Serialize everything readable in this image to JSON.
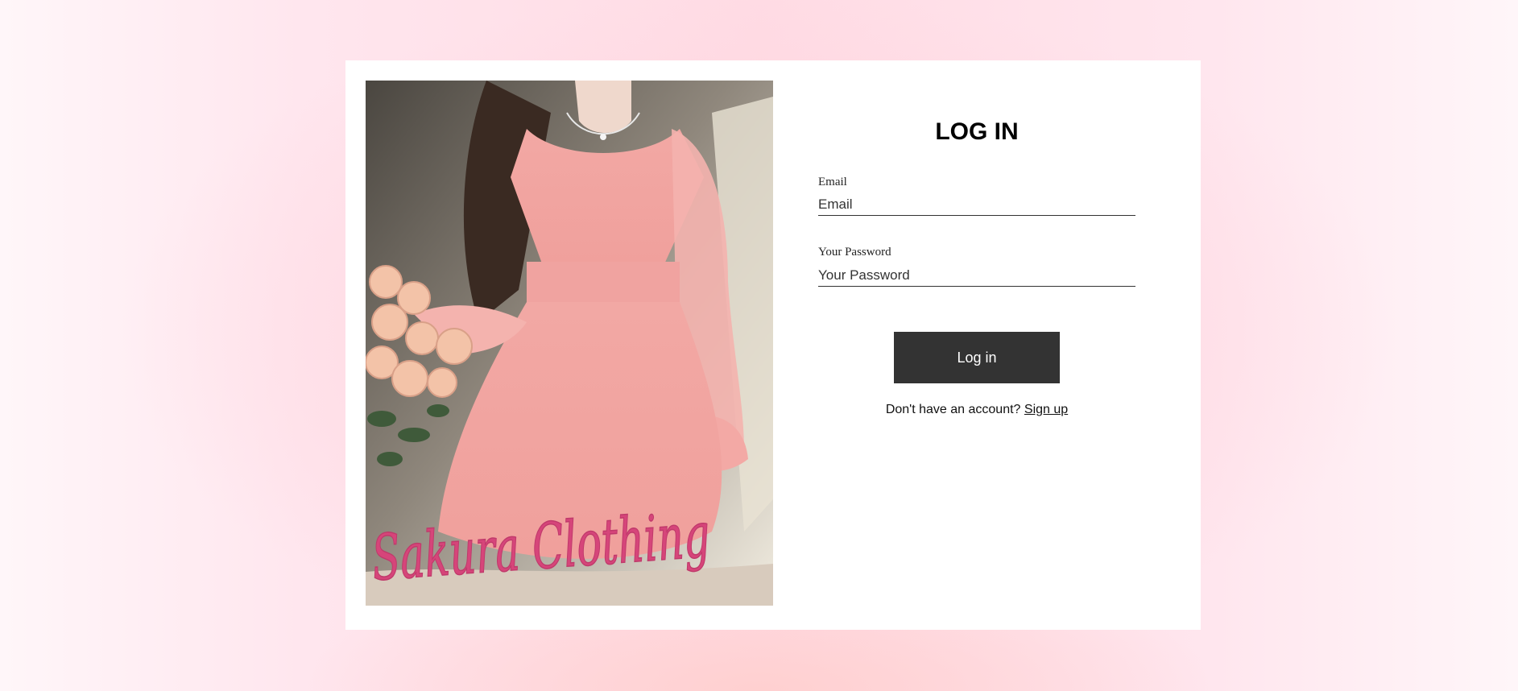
{
  "brand": {
    "logo_text": "Sakura Clothing"
  },
  "login": {
    "title": "LOG IN",
    "email_label": "Email",
    "email_placeholder": "Email",
    "password_label": "Your Password",
    "password_placeholder": "Your Password",
    "submit_label": "Log in",
    "signup_prompt": "Don't have an account?",
    "signup_link": "Sign up"
  },
  "colors": {
    "button_bg": "#333333",
    "logo_pink": "#d6457a",
    "background_pink": "#ffdbe4"
  }
}
